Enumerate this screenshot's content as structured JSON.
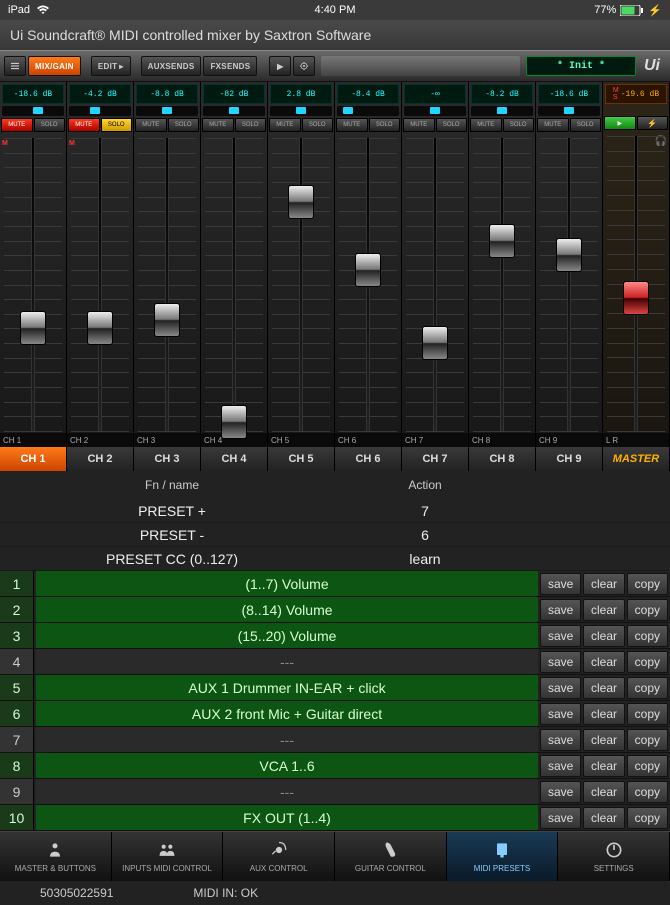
{
  "status": {
    "device": "iPad",
    "time": "4:40 PM",
    "battery": "77%"
  },
  "title": "Ui Soundcraft® MIDI controlled mixer by Saxtron Software",
  "toolbar": {
    "bars_icon": "≡",
    "mixgain": "MIX/GAIN",
    "edit": "EDIT",
    "auxsends": "AUXSENDS",
    "fxsends": "FXSENDS",
    "preset_display": "* Init *",
    "logo": "Ui"
  },
  "channels": [
    {
      "db": "-18.6 dB",
      "pan": 58,
      "mute": true,
      "solo": false,
      "fader": 65,
      "m": true,
      "foot": "CH 1",
      "tab": "CH 1"
    },
    {
      "db": "-4.2 dB",
      "pan": 42,
      "mute": true,
      "solo": true,
      "fader": 65,
      "m": true,
      "foot": "CH 2",
      "tab": "CH 2"
    },
    {
      "db": "-8.8 dB",
      "pan": 50,
      "mute": false,
      "solo": false,
      "fader": 62,
      "m": false,
      "foot": "CH 3",
      "tab": "CH 3"
    },
    {
      "db": "-82 dB",
      "pan": 50,
      "mute": false,
      "solo": false,
      "fader": 97,
      "m": false,
      "foot": "CH 4",
      "tab": "CH 4"
    },
    {
      "db": "2.8 dB",
      "pan": 50,
      "mute": false,
      "solo": false,
      "fader": 22,
      "m": false,
      "foot": "CH 5",
      "tab": "CH 5"
    },
    {
      "db": "-8.4 dB",
      "pan": 18,
      "mute": false,
      "solo": false,
      "fader": 45,
      "m": false,
      "foot": "CH 6",
      "tab": "CH 6"
    },
    {
      "db": "-∞",
      "pan": 50,
      "mute": false,
      "solo": false,
      "fader": 70,
      "m": false,
      "foot": "CH 7",
      "tab": "CH 7"
    },
    {
      "db": "-8.2 dB",
      "pan": 50,
      "mute": false,
      "solo": false,
      "fader": 35,
      "m": false,
      "foot": "CH 8",
      "tab": "CH 8"
    },
    {
      "db": "-18.6 dB",
      "pan": 50,
      "mute": false,
      "solo": false,
      "fader": 40,
      "m": false,
      "foot": "CH 9",
      "tab": "CH 9"
    }
  ],
  "master": {
    "db": "-19.6 dB",
    "fader": 55,
    "foot": "L  R",
    "tab": "MASTER"
  },
  "btn_labels": {
    "mute": "MUTE",
    "solo": "SOLO"
  },
  "table": {
    "headers": {
      "fn": "Fn / name",
      "action": "Action"
    },
    "preset_rows": [
      {
        "fn": "PRESET +",
        "action": "7"
      },
      {
        "fn": "PRESET -",
        "action": "6"
      },
      {
        "fn": "PRESET CC (0..127)",
        "action": "learn"
      }
    ],
    "actions": {
      "save": "save",
      "clear": "clear",
      "copy": "copy"
    },
    "rows": [
      {
        "n": "1",
        "desc": "(1..7) Volume",
        "empty": false
      },
      {
        "n": "2",
        "desc": "(8..14) Volume",
        "empty": false
      },
      {
        "n": "3",
        "desc": "(15..20) Volume",
        "empty": false
      },
      {
        "n": "4",
        "desc": "---",
        "empty": true
      },
      {
        "n": "5",
        "desc": "AUX 1 Drummer IN-EAR + click",
        "empty": false
      },
      {
        "n": "6",
        "desc": "AUX 2 front Mic + Guitar direct",
        "empty": false
      },
      {
        "n": "7",
        "desc": "---",
        "empty": true
      },
      {
        "n": "8",
        "desc": "VCA 1..6",
        "empty": false
      },
      {
        "n": "9",
        "desc": "---",
        "empty": true
      },
      {
        "n": "10",
        "desc": "FX OUT (1..4)",
        "empty": false
      }
    ]
  },
  "bottom_tabs": [
    {
      "label": "MASTER & BUTTONS"
    },
    {
      "label": "INPUTS MIDI CONTROL"
    },
    {
      "label": "AUX CONTROL"
    },
    {
      "label": "GUITAR CONTROL"
    },
    {
      "label": "MIDI PRESETS"
    },
    {
      "label": "SETTINGS"
    }
  ],
  "footer": {
    "left": "50305022591",
    "mid": "MIDI IN: OK"
  }
}
